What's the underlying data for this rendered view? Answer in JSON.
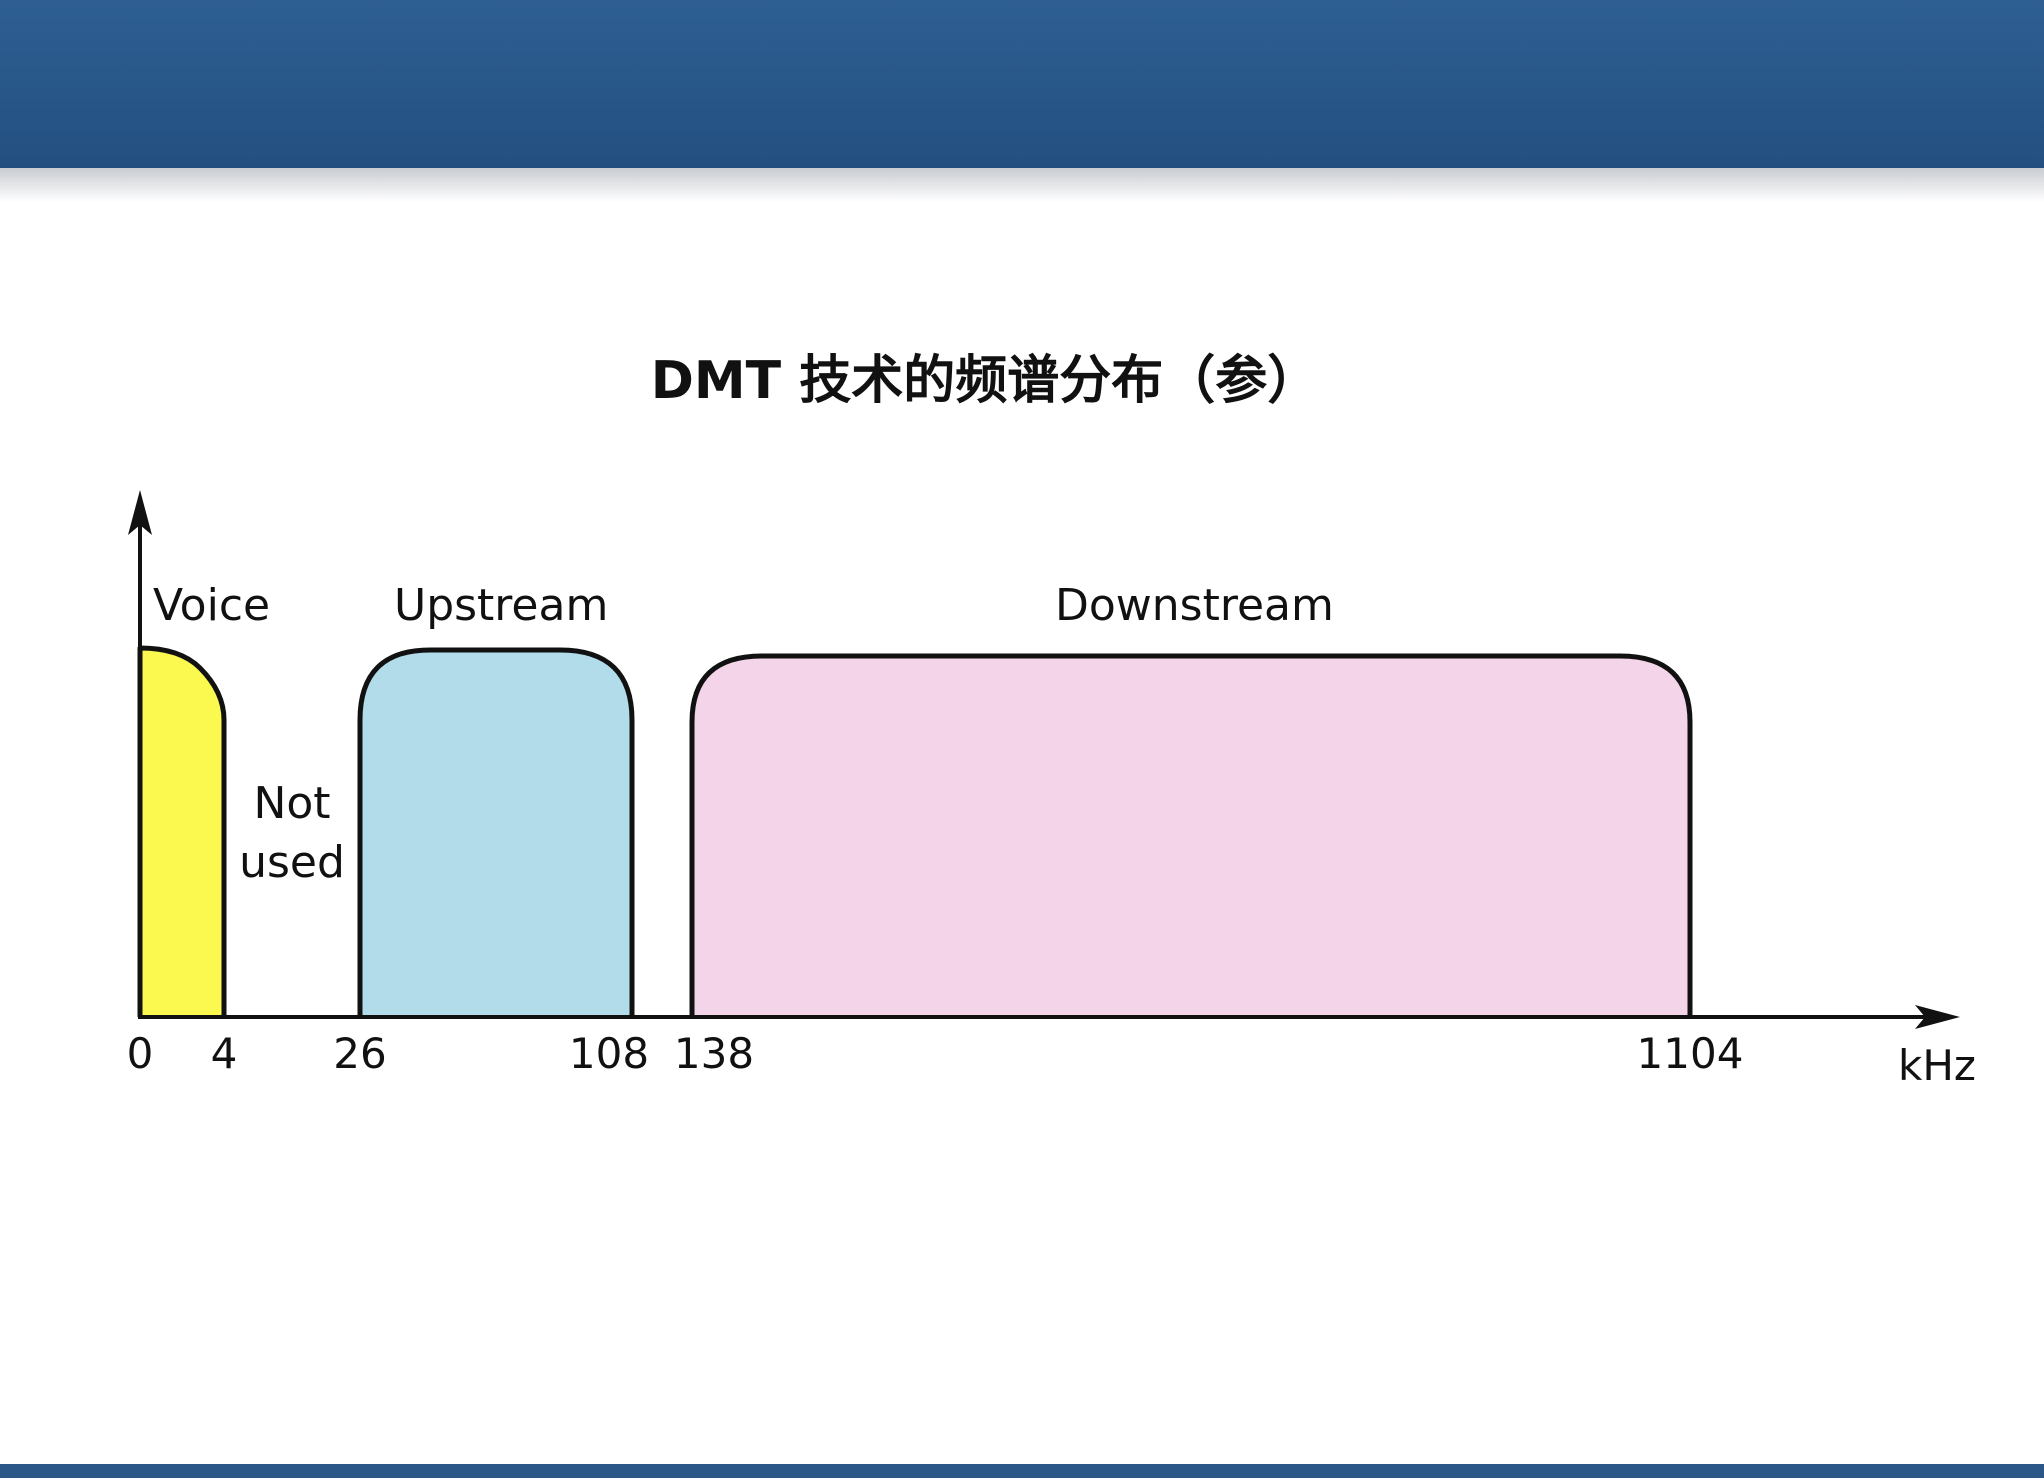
{
  "title": "DMT 技术的频谱分布（参）",
  "axis_unit": "kHz",
  "bands": [
    {
      "name": "voice",
      "label": "Voice",
      "start": 0,
      "end": 4,
      "color": "#fbf84f"
    },
    {
      "name": "upstream",
      "label": "Upstream",
      "start": 26,
      "end": 108,
      "color": "#b3dcea"
    },
    {
      "name": "downstream",
      "label": "Downstream",
      "start": 138,
      "end": 1104,
      "color": "#f3d4e8"
    }
  ],
  "gap_label_line1": "Not",
  "gap_label_line2": "used",
  "ticks": [
    {
      "name": "tick-0",
      "label": "0"
    },
    {
      "name": "tick-4",
      "label": "4"
    },
    {
      "name": "tick-26",
      "label": "26"
    },
    {
      "name": "tick-108",
      "label": "108"
    },
    {
      "name": "tick-138",
      "label": "138"
    },
    {
      "name": "tick-1104",
      "label": "1104"
    }
  ]
}
